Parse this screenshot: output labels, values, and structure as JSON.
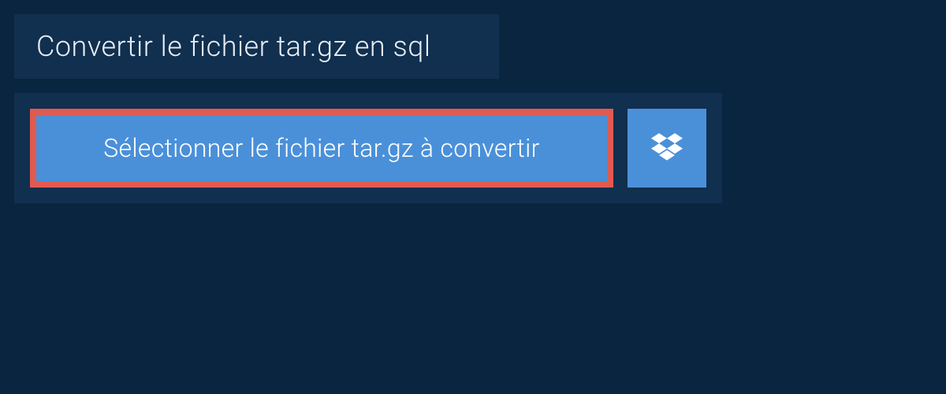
{
  "header": {
    "title": "Convertir le fichier tar.gz en sql"
  },
  "actions": {
    "select_file_label": "Sélectionner le fichier tar.gz à convertir"
  },
  "colors": {
    "background": "#0a2540",
    "panel": "#112f4f",
    "button": "#4a90d9",
    "highlight_border": "#e05a50",
    "text_light": "#e8eef5",
    "text_white": "#ffffff"
  }
}
